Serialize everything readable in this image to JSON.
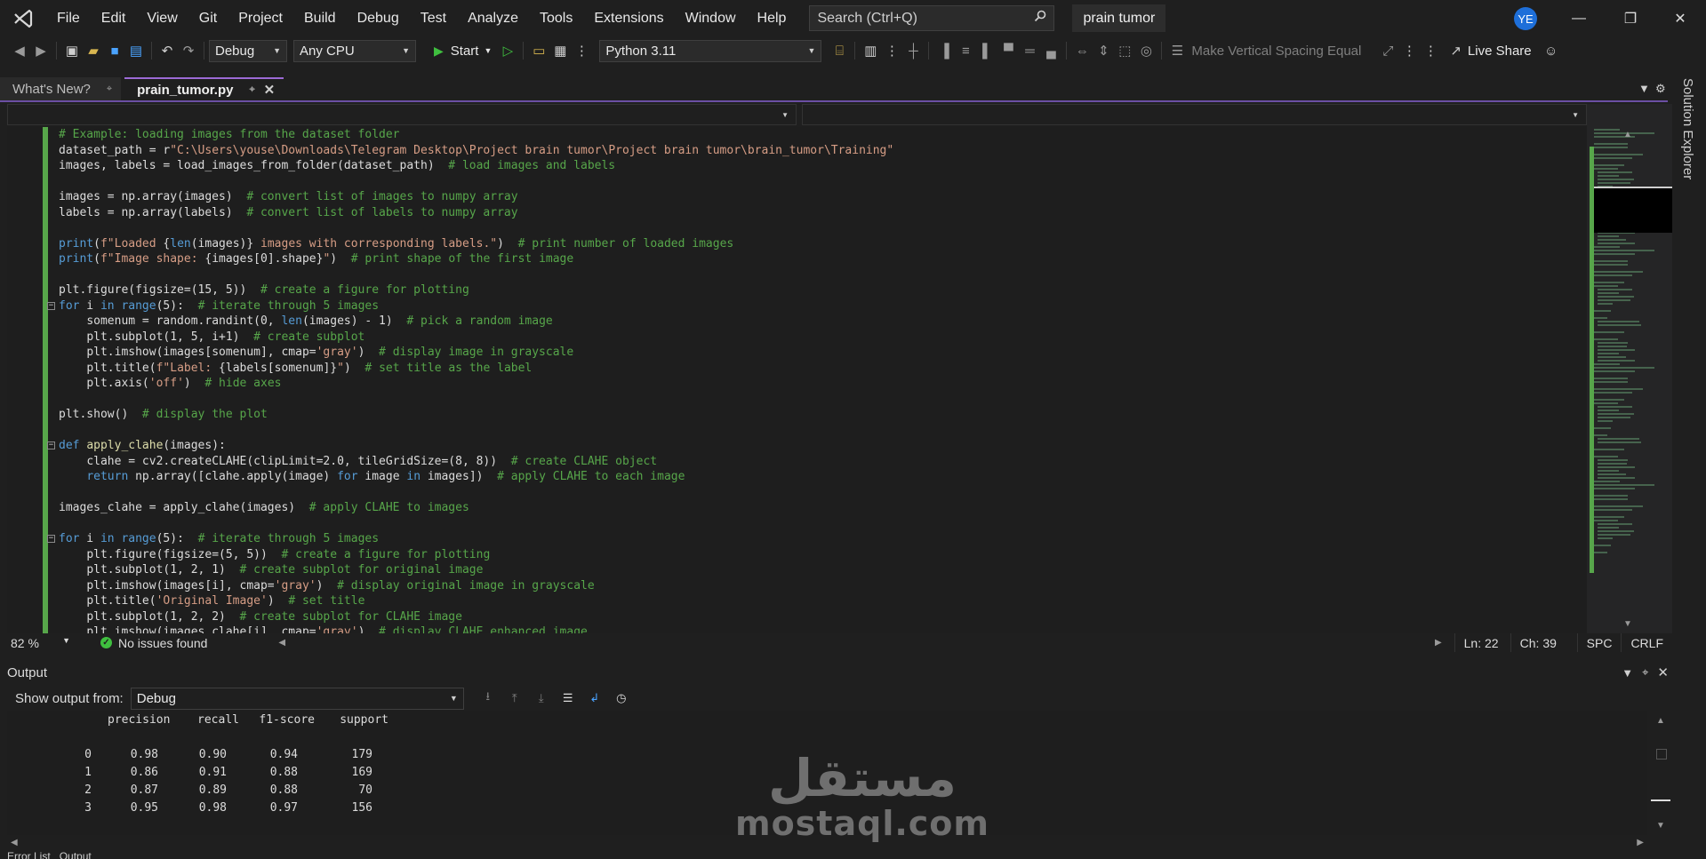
{
  "menu": [
    "File",
    "Edit",
    "View",
    "Git",
    "Project",
    "Build",
    "Debug",
    "Test",
    "Analyze",
    "Tools",
    "Extensions",
    "Window",
    "Help"
  ],
  "search": {
    "placeholder": "Search (Ctrl+Q)"
  },
  "solution_name": "prain tumor",
  "user_initials": "YE",
  "toolbar": {
    "configuration": "Debug",
    "platform": "Any CPU",
    "start_label": "Start",
    "python_env": "Python 3.11",
    "spacing_label": "Make Vertical Spacing Equal",
    "live_share_label": "Live Share"
  },
  "tabs": [
    {
      "label": "What's New?"
    },
    {
      "label": "prain_tumor.py"
    }
  ],
  "side_tab": "Solution Explorer",
  "editor": {
    "lines": [
      {
        "i": 0,
        "fold": false,
        "tokens": [
          [
            "cm",
            "# Example: loading images from the dataset folder"
          ]
        ]
      },
      {
        "i": 0,
        "fold": false,
        "tokens": [
          [
            "",
            "dataset_path = r"
          ],
          [
            "str",
            "\"C:\\Users\\youse\\Downloads\\Telegram Desktop\\Project brain tumor\\Project brain tumor\\brain_tumor\\Training\""
          ]
        ]
      },
      {
        "i": 0,
        "fold": false,
        "tokens": [
          [
            "",
            "images, labels = load_images_from_folder(dataset_path)  "
          ],
          [
            "cm",
            "# load images and labels"
          ]
        ]
      },
      {
        "i": 0,
        "fold": false,
        "tokens": []
      },
      {
        "i": 0,
        "fold": false,
        "tokens": [
          [
            "",
            "images = np.array(images)  "
          ],
          [
            "cm",
            "# convert list of images to numpy array"
          ]
        ]
      },
      {
        "i": 0,
        "fold": false,
        "tokens": [
          [
            "",
            "labels = np.array(labels)  "
          ],
          [
            "cm",
            "# convert list of labels to numpy array"
          ]
        ]
      },
      {
        "i": 0,
        "fold": false,
        "tokens": []
      },
      {
        "i": 0,
        "fold": false,
        "tokens": [
          [
            "kw",
            "print"
          ],
          [
            "",
            "("
          ],
          [
            "str",
            "f\"Loaded "
          ],
          [
            "",
            "{"
          ],
          [
            "kw",
            "len"
          ],
          [
            "",
            "(images)}"
          ],
          [
            "str",
            " images with corresponding labels.\""
          ],
          [
            "",
            ")  "
          ],
          [
            "cm",
            "# print number of loaded images"
          ]
        ]
      },
      {
        "i": 0,
        "fold": false,
        "tokens": [
          [
            "kw",
            "print"
          ],
          [
            "",
            "("
          ],
          [
            "str",
            "f\"Image shape: "
          ],
          [
            "",
            "{images[0].shape}"
          ],
          [
            "str",
            "\""
          ],
          [
            "",
            ")  "
          ],
          [
            "cm",
            "# print shape of the first image"
          ]
        ]
      },
      {
        "i": 0,
        "fold": false,
        "tokens": []
      },
      {
        "i": 0,
        "fold": false,
        "tokens": [
          [
            "",
            "plt.figure(figsize=(15, 5))  "
          ],
          [
            "cm",
            "# create a figure for plotting"
          ]
        ]
      },
      {
        "i": 0,
        "fold": true,
        "tokens": [
          [
            "kw",
            "for"
          ],
          [
            "",
            " i "
          ],
          [
            "kw",
            "in"
          ],
          [
            "",
            " "
          ],
          [
            "kw",
            "range"
          ],
          [
            "",
            "(5):  "
          ],
          [
            "cm",
            "# iterate through 5 images"
          ]
        ]
      },
      {
        "i": 1,
        "fold": false,
        "tokens": [
          [
            "",
            "somenum = random.randint(0, "
          ],
          [
            "kw",
            "len"
          ],
          [
            "",
            "(images) - 1)  "
          ],
          [
            "cm",
            "# pick a random image"
          ]
        ]
      },
      {
        "i": 1,
        "fold": false,
        "tokens": [
          [
            "",
            "plt.subplot(1, 5, i+1)  "
          ],
          [
            "cm",
            "# create subplot"
          ]
        ]
      },
      {
        "i": 1,
        "fold": false,
        "tokens": [
          [
            "",
            "plt.imshow(images[somenum], cmap="
          ],
          [
            "str",
            "'gray'"
          ],
          [
            "",
            ")  "
          ],
          [
            "cm",
            "# display image in grayscale"
          ]
        ]
      },
      {
        "i": 1,
        "fold": false,
        "tokens": [
          [
            "",
            "plt.title("
          ],
          [
            "str",
            "f\"Label: "
          ],
          [
            "",
            "{labels[somenum]}"
          ],
          [
            "str",
            "\""
          ],
          [
            "",
            ")  "
          ],
          [
            "cm",
            "# set title as the label"
          ]
        ]
      },
      {
        "i": 1,
        "fold": false,
        "tokens": [
          [
            "",
            "plt.axis("
          ],
          [
            "str",
            "'off'"
          ],
          [
            "",
            ")  "
          ],
          [
            "cm",
            "# hide axes"
          ]
        ]
      },
      {
        "i": 0,
        "fold": false,
        "tokens": []
      },
      {
        "i": 0,
        "fold": false,
        "tokens": [
          [
            "",
            "plt.show()  "
          ],
          [
            "cm",
            "# display the plot"
          ]
        ]
      },
      {
        "i": 0,
        "fold": false,
        "tokens": []
      },
      {
        "i": 0,
        "fold": true,
        "tokens": [
          [
            "kw",
            "def"
          ],
          [
            "",
            " "
          ],
          [
            "fn",
            "apply_clahe"
          ],
          [
            "",
            "(images):"
          ]
        ]
      },
      {
        "i": 1,
        "fold": false,
        "tokens": [
          [
            "",
            "clahe = cv2.createCLAHE(clipLimit=2.0, tileGridSize=(8, 8))  "
          ],
          [
            "cm",
            "# create CLAHE object"
          ]
        ]
      },
      {
        "i": 1,
        "fold": false,
        "tokens": [
          [
            "kw",
            "return"
          ],
          [
            "",
            " np.array([clahe.apply(image) "
          ],
          [
            "kw",
            "for"
          ],
          [
            "",
            " image "
          ],
          [
            "kw",
            "in"
          ],
          [
            "",
            " images])  "
          ],
          [
            "cm",
            "# apply CLAHE to each image"
          ]
        ]
      },
      {
        "i": 0,
        "fold": false,
        "tokens": []
      },
      {
        "i": 0,
        "fold": false,
        "tokens": [
          [
            "",
            "images_clahe = apply_clahe(images)  "
          ],
          [
            "cm",
            "# apply CLAHE to images"
          ]
        ]
      },
      {
        "i": 0,
        "fold": false,
        "tokens": []
      },
      {
        "i": 0,
        "fold": true,
        "tokens": [
          [
            "kw",
            "for"
          ],
          [
            "",
            " i "
          ],
          [
            "kw",
            "in"
          ],
          [
            "",
            " "
          ],
          [
            "kw",
            "range"
          ],
          [
            "",
            "(5):  "
          ],
          [
            "cm",
            "# iterate through 5 images"
          ]
        ]
      },
      {
        "i": 1,
        "fold": false,
        "tokens": [
          [
            "",
            "plt.figure(figsize=(5, 5))  "
          ],
          [
            "cm",
            "# create a figure for plotting"
          ]
        ]
      },
      {
        "i": 1,
        "fold": false,
        "tokens": [
          [
            "",
            "plt.subplot(1, 2, 1)  "
          ],
          [
            "cm",
            "# create subplot for original image"
          ]
        ]
      },
      {
        "i": 1,
        "fold": false,
        "tokens": [
          [
            "",
            "plt.imshow(images[i], cmap="
          ],
          [
            "str",
            "'gray'"
          ],
          [
            "",
            ")  "
          ],
          [
            "cm",
            "# display original image in grayscale"
          ]
        ]
      },
      {
        "i": 1,
        "fold": false,
        "tokens": [
          [
            "",
            "plt.title("
          ],
          [
            "str",
            "'Original Image'"
          ],
          [
            "",
            ")  "
          ],
          [
            "cm",
            "# set title"
          ]
        ]
      },
      {
        "i": 1,
        "fold": false,
        "tokens": [
          [
            "",
            "plt.subplot(1, 2, 2)  "
          ],
          [
            "cm",
            "# create subplot for CLAHE image"
          ]
        ]
      },
      {
        "i": 1,
        "fold": false,
        "tokens": [
          [
            "",
            "plt.imshow(images_clahe[i], cmap="
          ],
          [
            "str",
            "'gray'"
          ],
          [
            "",
            ")  "
          ],
          [
            "cm",
            "# display CLAHE enhanced image"
          ]
        ]
      }
    ]
  },
  "status": {
    "zoom": "82 %",
    "issues": "No issues found",
    "line": "Ln: 22",
    "char": "Ch: 39",
    "spacing": "SPC",
    "eol": "CRLF"
  },
  "output": {
    "title": "Output",
    "show_from_label": "Show output from:",
    "source": "Debug",
    "report": {
      "headers": [
        "precision",
        "recall",
        "f1-score",
        "support"
      ],
      "rows": [
        {
          "cls": "0",
          "precision": "0.98",
          "recall": "0.90",
          "f1": "0.94",
          "support": "179"
        },
        {
          "cls": "1",
          "precision": "0.86",
          "recall": "0.91",
          "f1": "0.88",
          "support": "169"
        },
        {
          "cls": "2",
          "precision": "0.87",
          "recall": "0.89",
          "f1": "0.88",
          "support": "70"
        },
        {
          "cls": "3",
          "precision": "0.95",
          "recall": "0.98",
          "f1": "0.97",
          "support": "156"
        }
      ]
    }
  },
  "bottom_tabs": [
    "Error List",
    "Output"
  ],
  "watermark": {
    "arabic": "مستقل",
    "latin": "mostaql.com"
  }
}
